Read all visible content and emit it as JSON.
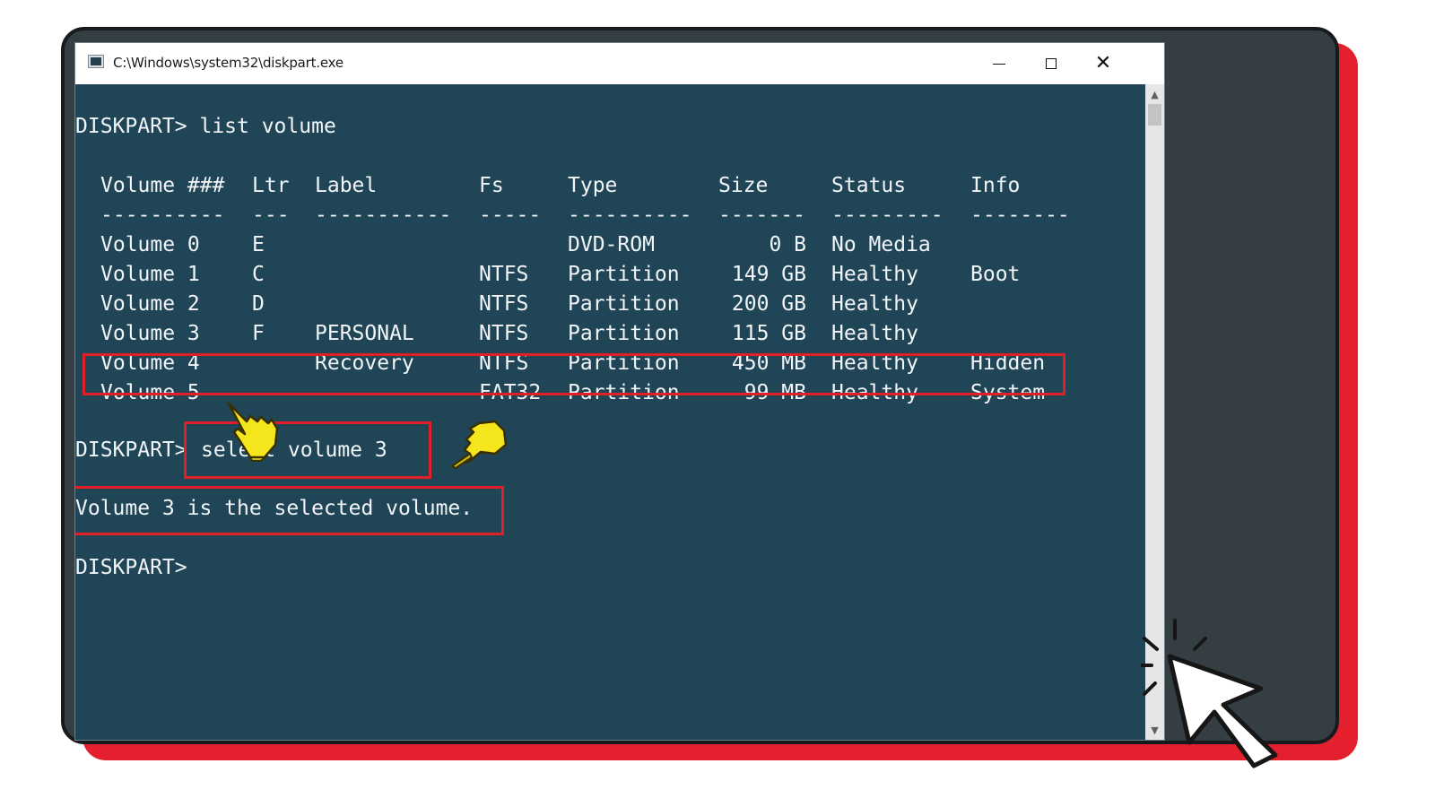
{
  "window": {
    "title": "C:\\Windows\\system32\\diskpart.exe",
    "minimize_glyph": "—",
    "maximize_glyph": "□",
    "close_glyph": "✕"
  },
  "console": {
    "prompt_list": "DISKPART> list volume",
    "headers": [
      "Volume ###",
      "Ltr",
      "Label",
      "Fs",
      "Type",
      "Size",
      "Status",
      "Info"
    ],
    "separators": [
      "----------",
      "---",
      "-----------",
      "-----",
      "----------",
      "-------",
      "---------",
      "--------"
    ],
    "rows": [
      [
        "Volume 0",
        "E",
        "",
        "",
        "DVD-ROM",
        "0 B",
        "No Media",
        ""
      ],
      [
        "Volume 1",
        "C",
        "",
        "NTFS",
        "Partition",
        "149 GB",
        "Healthy",
        "Boot"
      ],
      [
        "Volume 2",
        "D",
        "",
        "NTFS",
        "Partition",
        "200 GB",
        "Healthy",
        ""
      ],
      [
        "Volume 3",
        "F",
        "PERSONAL",
        "NTFS",
        "Partition",
        "115 GB",
        "Healthy",
        ""
      ],
      [
        "Volume 4",
        "",
        "Recovery",
        "NTFS",
        "Partition",
        "450 MB",
        "Healthy",
        "Hidden"
      ],
      [
        "Volume 5",
        "",
        "",
        "FAT32",
        "Partition",
        "99 MB",
        "Healthy",
        "System"
      ]
    ],
    "prompt_prefix": "DISKPART>",
    "select_command": "select volume 3",
    "select_result": "Volume 3 is the selected volume.",
    "final_prompt": "DISKPART>"
  },
  "colors": {
    "console_bg": "#1f4557",
    "highlight": "#e01f26",
    "accent_red": "#e4202e",
    "pointer_hand": "#f5e51c"
  },
  "icons": [
    "console-app-icon",
    "pointing-hand-icon",
    "mouse-cursor-icon",
    "scroll-up-arrow-icon",
    "scroll-down-arrow-icon"
  ]
}
